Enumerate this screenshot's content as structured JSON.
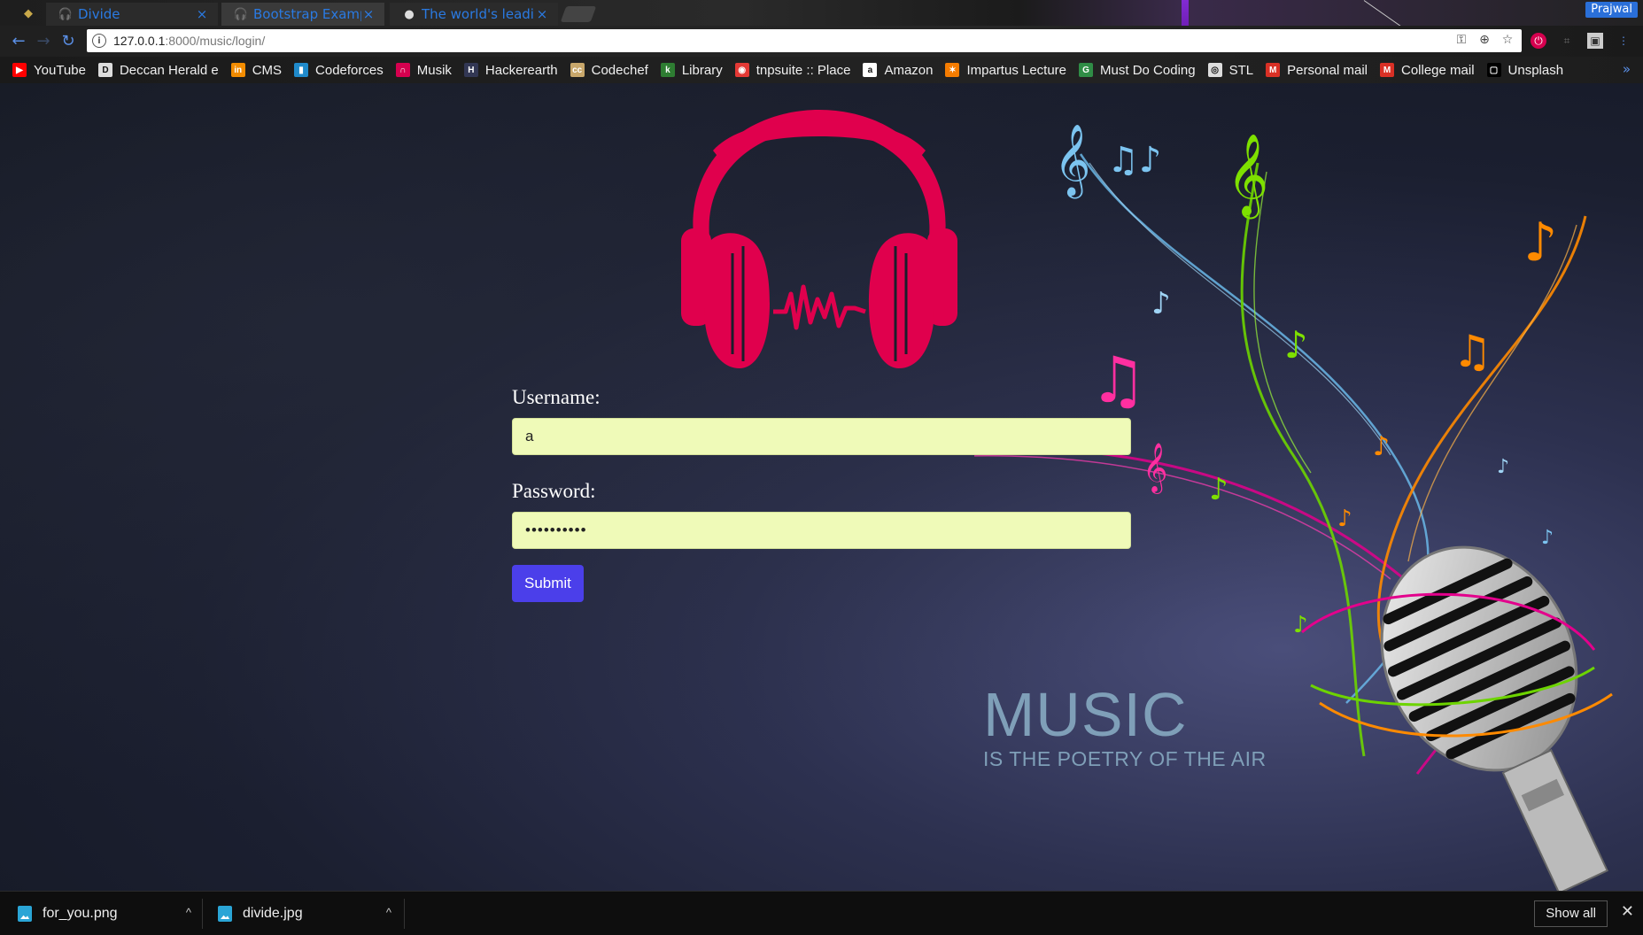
{
  "browser": {
    "tabs": [
      {
        "title": "Divide",
        "active": false
      },
      {
        "title": "Bootstrap Example",
        "active": true
      },
      {
        "title": "The world's leadin",
        "active": false
      }
    ],
    "profile_name": "Prajwal",
    "url_host": "127.0.0.1",
    "url_path": ":8000/music/login/",
    "bookmarks": [
      {
        "label": "YouTube",
        "icon": "youtube-icon",
        "color": "#ff0000"
      },
      {
        "label": "Deccan Herald e",
        "icon": "deccan-herald-icon",
        "color": "#dddddd"
      },
      {
        "label": "CMS",
        "icon": "cms-icon",
        "color": "#f28c00"
      },
      {
        "label": "Codeforces",
        "icon": "codeforces-icon",
        "color": "#1f8acb"
      },
      {
        "label": "Musik",
        "icon": "headphones-icon",
        "color": "#d6004f"
      },
      {
        "label": "Hackerearth",
        "icon": "hackerearth-icon",
        "color": "#323754"
      },
      {
        "label": "Codechef",
        "icon": "codechef-icon",
        "color": "#c8a76b"
      },
      {
        "label": "Library",
        "icon": "library-icon",
        "color": "#2e7d32"
      },
      {
        "label": "tnpsuite :: Place",
        "icon": "tnpsuite-icon",
        "color": "#e53935"
      },
      {
        "label": "Amazon",
        "icon": "amazon-icon",
        "color": "#ffffff"
      },
      {
        "label": "Impartus Lecture",
        "icon": "impartus-icon",
        "color": "#f57c00"
      },
      {
        "label": "Must Do Coding",
        "icon": "geeksforgeeks-icon",
        "color": "#2f8d46"
      },
      {
        "label": "STL",
        "icon": "stl-icon",
        "color": "#dddddd"
      },
      {
        "label": "Personal mail",
        "icon": "gmail-icon",
        "color": "#d93025"
      },
      {
        "label": "College mail",
        "icon": "gmail-icon",
        "color": "#d93025"
      },
      {
        "label": "Unsplash",
        "icon": "unsplash-icon",
        "color": "#000000"
      }
    ]
  },
  "login": {
    "username_label": "Username:",
    "username_value": "a",
    "password_label": "Password:",
    "password_value": "••••••••••",
    "submit_label": "Submit"
  },
  "hero": {
    "title": "MUSIC",
    "subtitle": "IS THE POETRY OF THE AIR",
    "accent_color": "#e0004d"
  },
  "downloads": {
    "items": [
      {
        "name": "for_you.png"
      },
      {
        "name": "divide.jpg"
      }
    ],
    "show_all_label": "Show all"
  }
}
